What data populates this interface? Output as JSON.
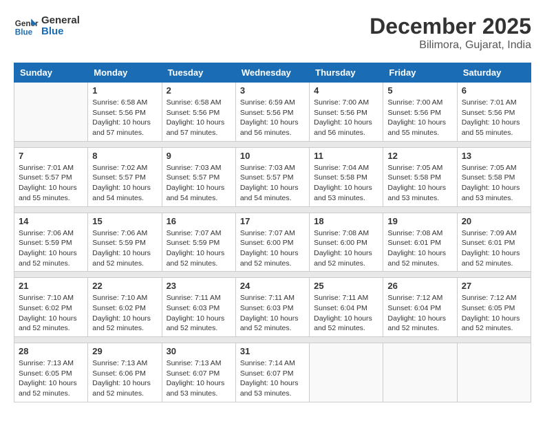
{
  "logo": {
    "general": "General",
    "blue": "Blue"
  },
  "title": {
    "month": "December 2025",
    "location": "Bilimora, Gujarat, India"
  },
  "headers": [
    "Sunday",
    "Monday",
    "Tuesday",
    "Wednesday",
    "Thursday",
    "Friday",
    "Saturday"
  ],
  "weeks": [
    {
      "days": [
        {
          "num": "",
          "empty": true
        },
        {
          "num": "1",
          "sunrise": "6:58 AM",
          "sunset": "5:56 PM",
          "daylight": "10 hours and 57 minutes."
        },
        {
          "num": "2",
          "sunrise": "6:58 AM",
          "sunset": "5:56 PM",
          "daylight": "10 hours and 57 minutes."
        },
        {
          "num": "3",
          "sunrise": "6:59 AM",
          "sunset": "5:56 PM",
          "daylight": "10 hours and 56 minutes."
        },
        {
          "num": "4",
          "sunrise": "7:00 AM",
          "sunset": "5:56 PM",
          "daylight": "10 hours and 56 minutes."
        },
        {
          "num": "5",
          "sunrise": "7:00 AM",
          "sunset": "5:56 PM",
          "daylight": "10 hours and 55 minutes."
        },
        {
          "num": "6",
          "sunrise": "7:01 AM",
          "sunset": "5:56 PM",
          "daylight": "10 hours and 55 minutes."
        }
      ]
    },
    {
      "days": [
        {
          "num": "7",
          "sunrise": "7:01 AM",
          "sunset": "5:57 PM",
          "daylight": "10 hours and 55 minutes."
        },
        {
          "num": "8",
          "sunrise": "7:02 AM",
          "sunset": "5:57 PM",
          "daylight": "10 hours and 54 minutes."
        },
        {
          "num": "9",
          "sunrise": "7:03 AM",
          "sunset": "5:57 PM",
          "daylight": "10 hours and 54 minutes."
        },
        {
          "num": "10",
          "sunrise": "7:03 AM",
          "sunset": "5:57 PM",
          "daylight": "10 hours and 54 minutes."
        },
        {
          "num": "11",
          "sunrise": "7:04 AM",
          "sunset": "5:58 PM",
          "daylight": "10 hours and 53 minutes."
        },
        {
          "num": "12",
          "sunrise": "7:05 AM",
          "sunset": "5:58 PM",
          "daylight": "10 hours and 53 minutes."
        },
        {
          "num": "13",
          "sunrise": "7:05 AM",
          "sunset": "5:58 PM",
          "daylight": "10 hours and 53 minutes."
        }
      ]
    },
    {
      "days": [
        {
          "num": "14",
          "sunrise": "7:06 AM",
          "sunset": "5:59 PM",
          "daylight": "10 hours and 52 minutes."
        },
        {
          "num": "15",
          "sunrise": "7:06 AM",
          "sunset": "5:59 PM",
          "daylight": "10 hours and 52 minutes."
        },
        {
          "num": "16",
          "sunrise": "7:07 AM",
          "sunset": "5:59 PM",
          "daylight": "10 hours and 52 minutes."
        },
        {
          "num": "17",
          "sunrise": "7:07 AM",
          "sunset": "6:00 PM",
          "daylight": "10 hours and 52 minutes."
        },
        {
          "num": "18",
          "sunrise": "7:08 AM",
          "sunset": "6:00 PM",
          "daylight": "10 hours and 52 minutes."
        },
        {
          "num": "19",
          "sunrise": "7:08 AM",
          "sunset": "6:01 PM",
          "daylight": "10 hours and 52 minutes."
        },
        {
          "num": "20",
          "sunrise": "7:09 AM",
          "sunset": "6:01 PM",
          "daylight": "10 hours and 52 minutes."
        }
      ]
    },
    {
      "days": [
        {
          "num": "21",
          "sunrise": "7:10 AM",
          "sunset": "6:02 PM",
          "daylight": "10 hours and 52 minutes."
        },
        {
          "num": "22",
          "sunrise": "7:10 AM",
          "sunset": "6:02 PM",
          "daylight": "10 hours and 52 minutes."
        },
        {
          "num": "23",
          "sunrise": "7:11 AM",
          "sunset": "6:03 PM",
          "daylight": "10 hours and 52 minutes."
        },
        {
          "num": "24",
          "sunrise": "7:11 AM",
          "sunset": "6:03 PM",
          "daylight": "10 hours and 52 minutes."
        },
        {
          "num": "25",
          "sunrise": "7:11 AM",
          "sunset": "6:04 PM",
          "daylight": "10 hours and 52 minutes."
        },
        {
          "num": "26",
          "sunrise": "7:12 AM",
          "sunset": "6:04 PM",
          "daylight": "10 hours and 52 minutes."
        },
        {
          "num": "27",
          "sunrise": "7:12 AM",
          "sunset": "6:05 PM",
          "daylight": "10 hours and 52 minutes."
        }
      ]
    },
    {
      "days": [
        {
          "num": "28",
          "sunrise": "7:13 AM",
          "sunset": "6:05 PM",
          "daylight": "10 hours and 52 minutes."
        },
        {
          "num": "29",
          "sunrise": "7:13 AM",
          "sunset": "6:06 PM",
          "daylight": "10 hours and 52 minutes."
        },
        {
          "num": "30",
          "sunrise": "7:13 AM",
          "sunset": "6:07 PM",
          "daylight": "10 hours and 53 minutes."
        },
        {
          "num": "31",
          "sunrise": "7:14 AM",
          "sunset": "6:07 PM",
          "daylight": "10 hours and 53 minutes."
        },
        {
          "num": "",
          "empty": true
        },
        {
          "num": "",
          "empty": true
        },
        {
          "num": "",
          "empty": true
        }
      ]
    }
  ]
}
